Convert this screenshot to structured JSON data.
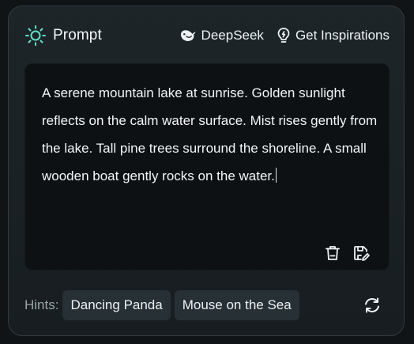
{
  "header": {
    "title": "Prompt",
    "title_icon": "sun-icon",
    "actions": [
      {
        "label": "DeepSeek",
        "icon": "whale-icon"
      },
      {
        "label": "Get Inspirations",
        "icon": "lightbulb-icon"
      }
    ]
  },
  "prompt": {
    "text": "A serene mountain lake at sunrise. Golden sunlight reflects on the calm water surface. Mist rises gently from the lake. Tall pine trees surround the shoreline. A small wooden boat gently rocks on the water.",
    "icons": [
      "trash-icon",
      "save-edit-icon"
    ]
  },
  "hints": {
    "label": "Hints:",
    "items": [
      "Dancing Panda",
      "Mouse on the Sea"
    ],
    "refresh_icon": "refresh-icon"
  },
  "colors": {
    "accent": "#5fe3c8",
    "background": "#101417",
    "card": "#1b2226",
    "input": "#0d1114",
    "chip": "#273035"
  }
}
